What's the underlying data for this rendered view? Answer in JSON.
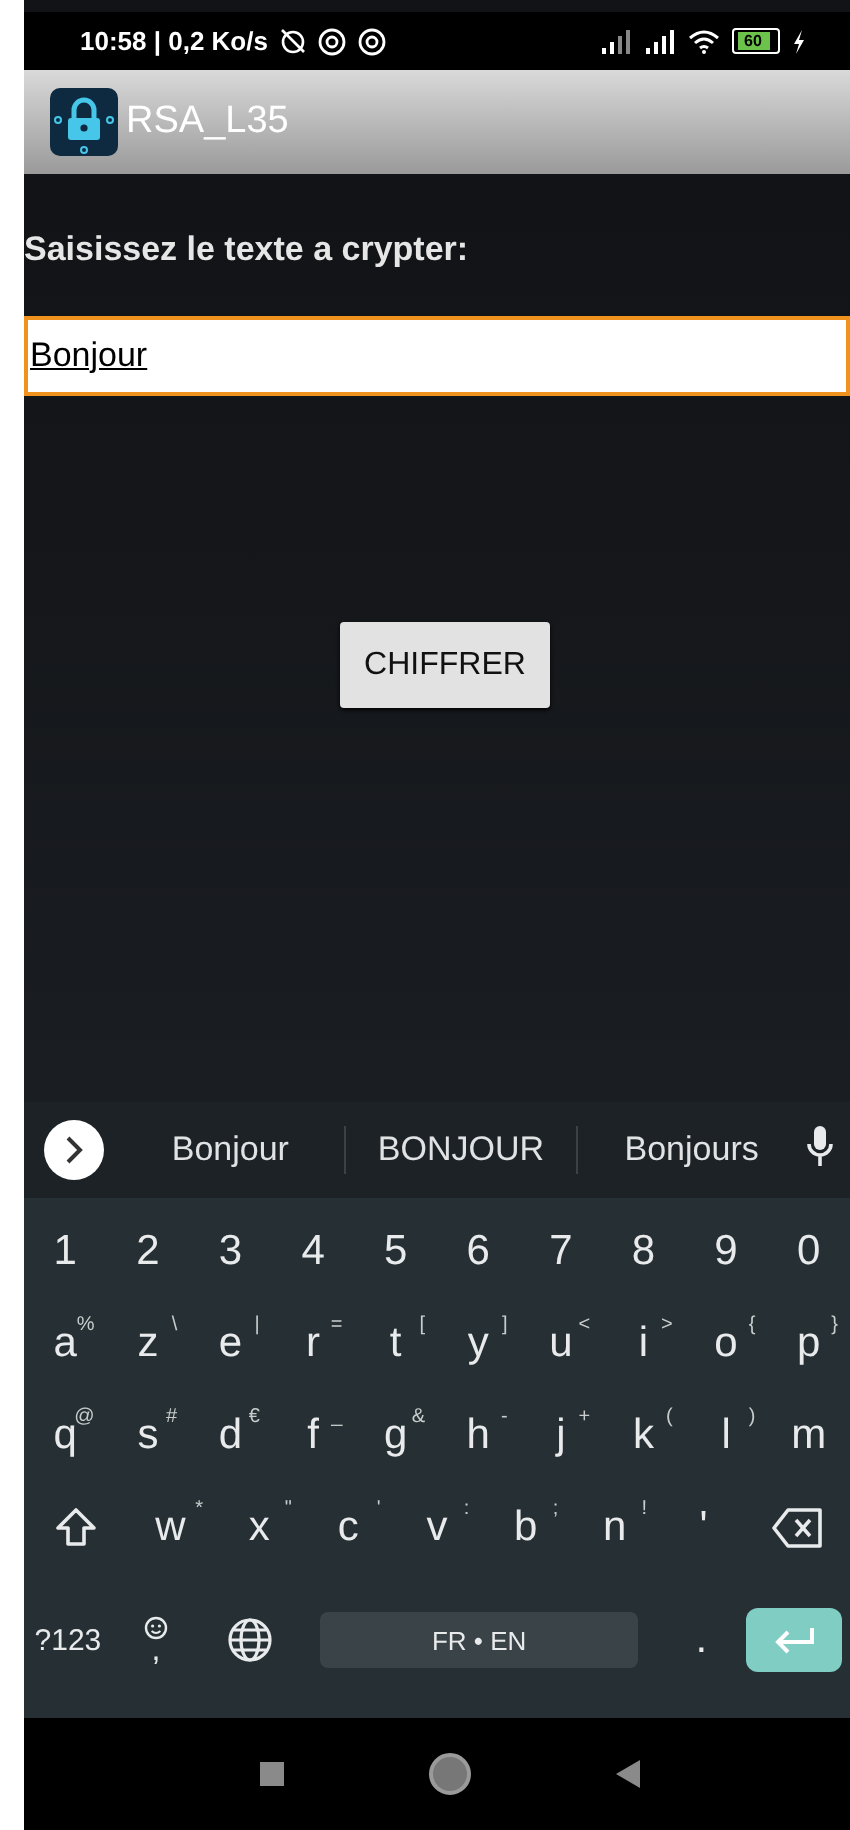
{
  "status_bar": {
    "time": "10:58 | 0,2 Ko/s",
    "battery": "60"
  },
  "app_bar": {
    "title": "RSA_L35"
  },
  "form": {
    "label": "Saisissez le texte a crypter:",
    "input": {
      "value": "Bonjour",
      "focused": true
    },
    "button": "CHIFFRER"
  },
  "keyboard": {
    "suggestions": [
      "Bonjour",
      "BONJOUR",
      "Bonjours"
    ],
    "rows": [
      [
        {
          "kind": "char",
          "label": "1"
        },
        {
          "kind": "char",
          "label": "2"
        },
        {
          "kind": "char",
          "label": "3"
        },
        {
          "kind": "char",
          "label": "4"
        },
        {
          "kind": "char",
          "label": "5"
        },
        {
          "kind": "char",
          "label": "6"
        },
        {
          "kind": "char",
          "label": "7"
        },
        {
          "kind": "char",
          "label": "8"
        },
        {
          "kind": "char",
          "label": "9"
        },
        {
          "kind": "char",
          "label": "0"
        }
      ],
      [
        {
          "kind": "char",
          "label": "a",
          "hint": "%"
        },
        {
          "kind": "char",
          "label": "z",
          "hint": "\\"
        },
        {
          "kind": "char",
          "label": "e",
          "hint": "|"
        },
        {
          "kind": "char",
          "label": "r",
          "hint": "="
        },
        {
          "kind": "char",
          "label": "t",
          "hint": "["
        },
        {
          "kind": "char",
          "label": "y",
          "hint": "]"
        },
        {
          "kind": "char",
          "label": "u",
          "hint": "<"
        },
        {
          "kind": "char",
          "label": "i",
          "hint": ">"
        },
        {
          "kind": "char",
          "label": "o",
          "hint": "{"
        },
        {
          "kind": "char",
          "label": "p",
          "hint": "}"
        }
      ],
      [
        {
          "kind": "char",
          "label": "q",
          "hint": "@"
        },
        {
          "kind": "char",
          "label": "s",
          "hint": "#"
        },
        {
          "kind": "char",
          "label": "d",
          "hint": "€"
        },
        {
          "kind": "char",
          "label": "f",
          "hint": "_"
        },
        {
          "kind": "char",
          "label": "g",
          "hint": "&"
        },
        {
          "kind": "char",
          "label": "h",
          "hint": "-"
        },
        {
          "kind": "char",
          "label": "j",
          "hint": "+"
        },
        {
          "kind": "char",
          "label": "k",
          "hint": "("
        },
        {
          "kind": "char",
          "label": "l",
          "hint": ")"
        },
        {
          "kind": "char",
          "label": "m"
        }
      ],
      [
        {
          "kind": "shift"
        },
        {
          "kind": "char",
          "label": "w",
          "hint": "*"
        },
        {
          "kind": "char",
          "label": "x",
          "hint": "\""
        },
        {
          "kind": "char",
          "label": "c",
          "hint": "'"
        },
        {
          "kind": "char",
          "label": "v",
          "hint": ":"
        },
        {
          "kind": "char",
          "label": "b",
          "hint": ";"
        },
        {
          "kind": "char",
          "label": "n",
          "hint": "!"
        },
        {
          "kind": "char",
          "label": "'"
        },
        {
          "kind": "backspace"
        }
      ]
    ],
    "bottom_bar": [
      {
        "kind": "symbols",
        "label": "?123"
      },
      {
        "kind": "emoji",
        "label": ","
      },
      {
        "kind": "globe"
      },
      {
        "kind": "space",
        "label": "FR • EN"
      },
      {
        "kind": "char",
        "label": "."
      },
      {
        "kind": "enter"
      }
    ]
  }
}
